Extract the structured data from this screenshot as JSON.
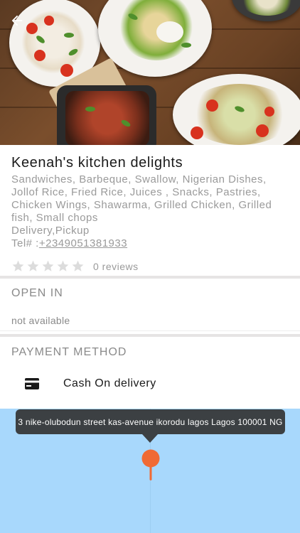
{
  "hero": {
    "back_icon": "arrow-left-icon"
  },
  "restaurant": {
    "name": "Keenah's kitchen delights",
    "cuisines": "Sandwiches, Barbeque, Swallow, Nigerian Dishes, Jollof Rice, Fried Rice, Juices , Snacks, Pastries, Chicken Wings, Shawarma, Grilled Chicken, Grilled fish, Small chops",
    "delivery_options": "Delivery,Pickup",
    "tel_prefix": "Tel# :",
    "phone": "+2349051381933",
    "rating": 0,
    "rating_max": 5,
    "reviews": "0 reviews"
  },
  "open_in": {
    "title": "OPEN IN",
    "status": "not available"
  },
  "payment": {
    "title": "PAYMENT METHOD",
    "icon": "credit-card-icon",
    "method": "Cash On delivery"
  },
  "map": {
    "address": "3 nike-olubodun street kas-avenue ikorodu lagos Lagos 100001 NG",
    "pin_icon": "map-pin-icon",
    "pin_color": "#f06a34",
    "background_color": "#a8d8fc"
  },
  "colors": {
    "star": "#dcdcdc",
    "divider": "#e6e4e4",
    "tooltip": "#3c4043"
  }
}
